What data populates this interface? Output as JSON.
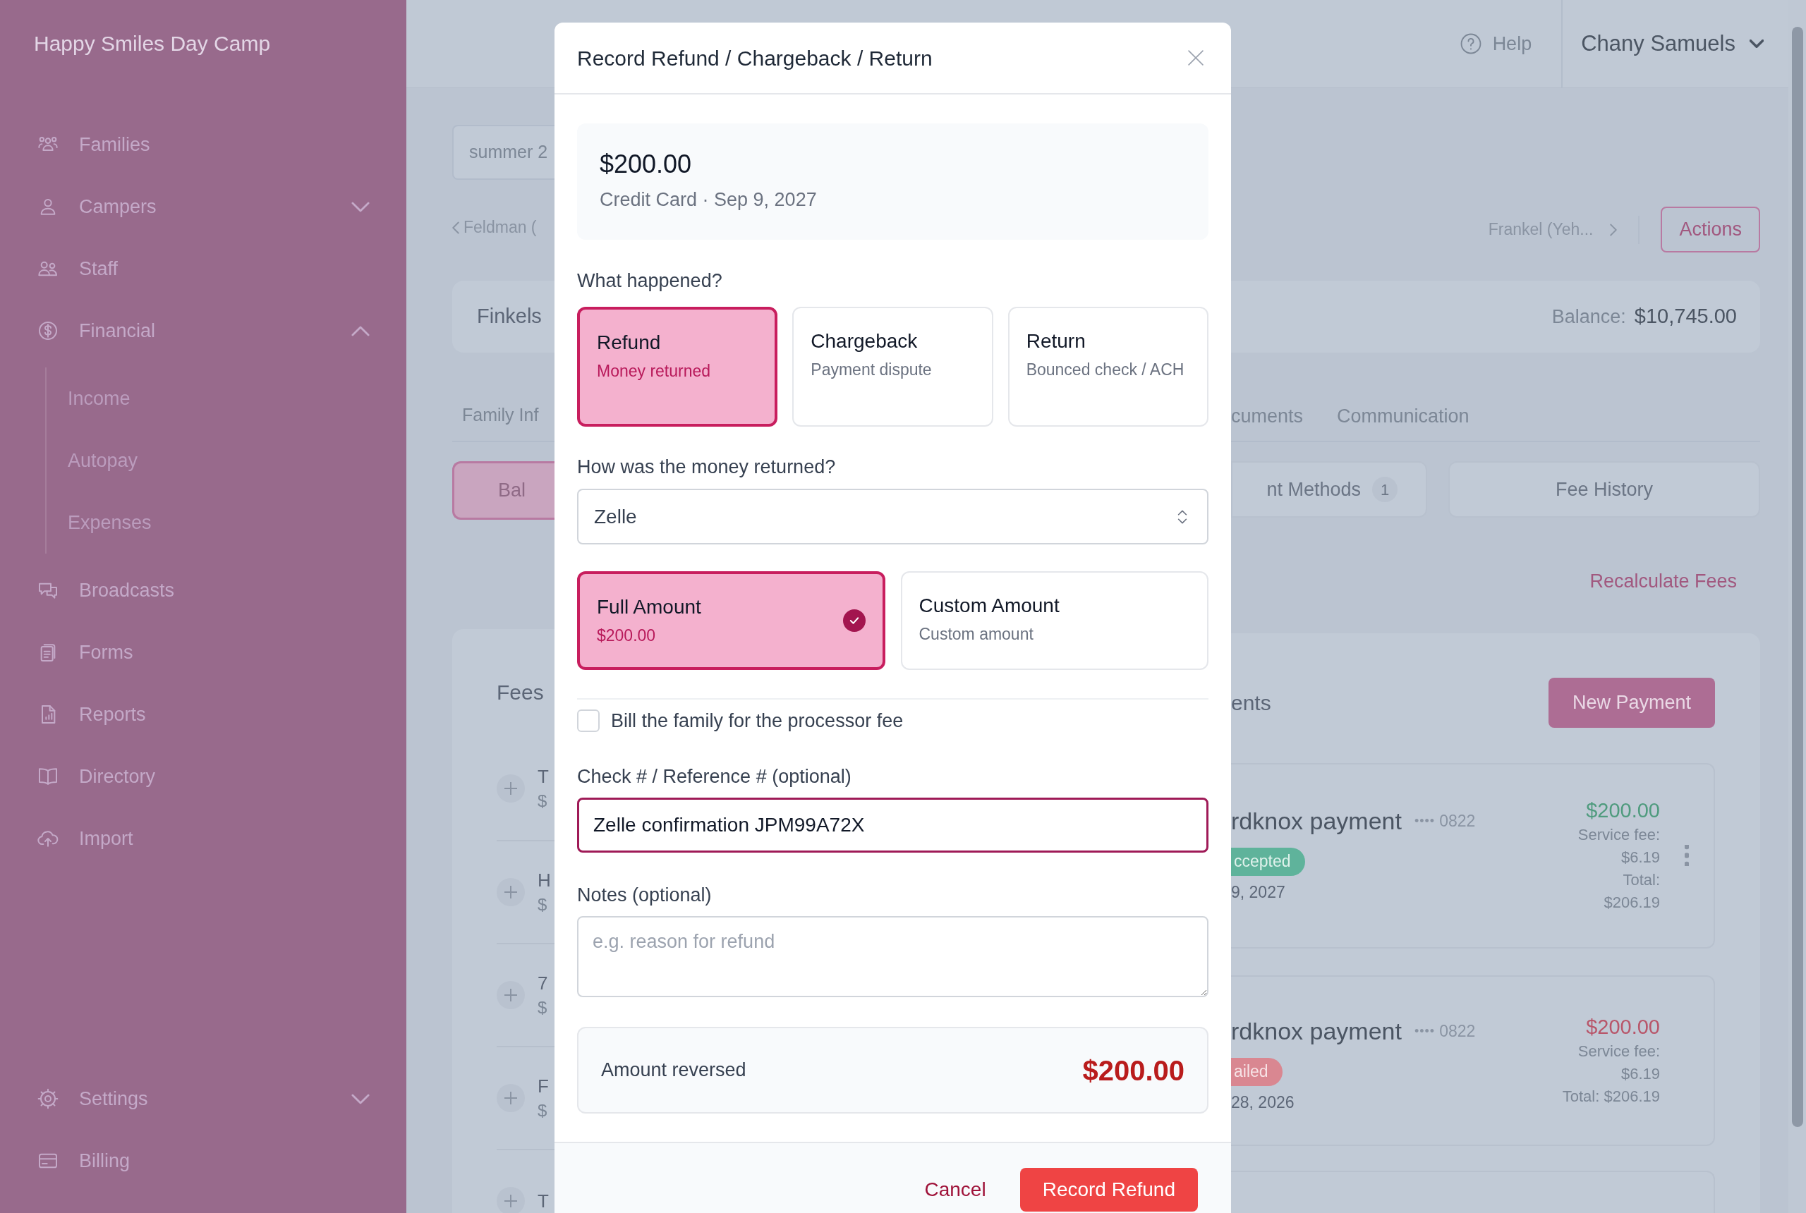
{
  "sidebar": {
    "title": "Happy Smiles Day Camp",
    "items": [
      {
        "label": "Families"
      },
      {
        "label": "Campers",
        "expanded": false
      },
      {
        "label": "Staff"
      },
      {
        "label": "Financial",
        "expanded": true,
        "children": [
          {
            "label": "Income"
          },
          {
            "label": "Autopay"
          },
          {
            "label": "Expenses"
          }
        ]
      },
      {
        "label": "Broadcasts"
      },
      {
        "label": "Forms"
      },
      {
        "label": "Reports"
      },
      {
        "label": "Directory"
      },
      {
        "label": "Import"
      }
    ],
    "bottom_items": [
      {
        "label": "Settings",
        "expanded": false
      },
      {
        "label": "Billing"
      }
    ]
  },
  "header": {
    "help": "Help",
    "user": "Chany Samuels"
  },
  "page": {
    "search_value": "summer 2",
    "prev_family": "Feldman (",
    "next_family": "Frankel (Yeh...",
    "actions": "Actions",
    "family_name": "Finkels",
    "balance_label": "Balance:",
    "balance": "$10,745.00",
    "tabs": [
      {
        "label": "Family Inf"
      },
      {
        "label": "cuments"
      },
      {
        "label": "Communication"
      }
    ],
    "sub_tabs": [
      {
        "label": "Bal",
        "selected": true
      },
      {
        "label": "nt Methods",
        "count": "1",
        "selected": false
      },
      {
        "label": "Fee History",
        "selected": false
      }
    ],
    "recalculate": "Recalculate Fees",
    "fees": {
      "title": "Fees",
      "rows": [
        {
          "name": "T",
          "amount": "$"
        },
        {
          "name": "H",
          "amount": "$"
        },
        {
          "name": "7",
          "amount": "$"
        },
        {
          "name": "F",
          "amount": "$"
        },
        {
          "name": "T"
        }
      ]
    },
    "payments": {
      "title": "ents",
      "new_button": "New Payment",
      "items": [
        {
          "title": "rdknox payment",
          "card_dots": "••••",
          "card_last4": "0822",
          "status": "ccepted",
          "kind": "accepted",
          "date": "9, 2027",
          "amount": "$200.00",
          "fee_lines": [
            "Service fee:",
            "$6.19",
            "Total:",
            "$206.19"
          ],
          "menu": true
        },
        {
          "title": "rdknox payment",
          "card_dots": "••••",
          "card_last4": "0822",
          "status": "ailed",
          "kind": "failed",
          "date": "28, 2026",
          "amount": "$200.00",
          "fee_lines": [
            "Service fee:",
            "$6.19",
            "Total: $206.19"
          ],
          "menu": false
        }
      ]
    }
  },
  "modal": {
    "title": "Record Refund / Chargeback / Return",
    "payment": {
      "amount": "$200.00",
      "details": "Credit Card · Sep 9, 2027"
    },
    "type_label": "What happened?",
    "types": [
      {
        "label": "Refund",
        "description": "Money returned",
        "selected": true
      },
      {
        "label": "Chargeback",
        "description": "Payment dispute",
        "selected": false
      },
      {
        "label": "Return",
        "description": "Bounced check / ACH",
        "selected": false
      }
    ],
    "method_label": "How was the money returned?",
    "method": "Zelle",
    "amount_options": [
      {
        "label": "Full Amount",
        "description": "$200.00",
        "selected": true
      },
      {
        "label": "Custom Amount",
        "description": "Custom amount",
        "selected": false
      }
    ],
    "bill_fee": {
      "label": "Bill the family for the processor fee",
      "checked": false
    },
    "reference": {
      "label": "Check # / Reference # (optional)",
      "value": "Zelle confirmation JPM99A72X",
      "focused": true
    },
    "notes": {
      "label": "Notes (optional)",
      "placeholder": "e.g. reason for refund"
    },
    "summary": {
      "label": "Amount reversed",
      "amount": "$200.00"
    },
    "buttons": [
      {
        "label": "Cancel",
        "kind": "link"
      },
      {
        "label": "Record Refund",
        "kind": "primary"
      }
    ]
  }
}
